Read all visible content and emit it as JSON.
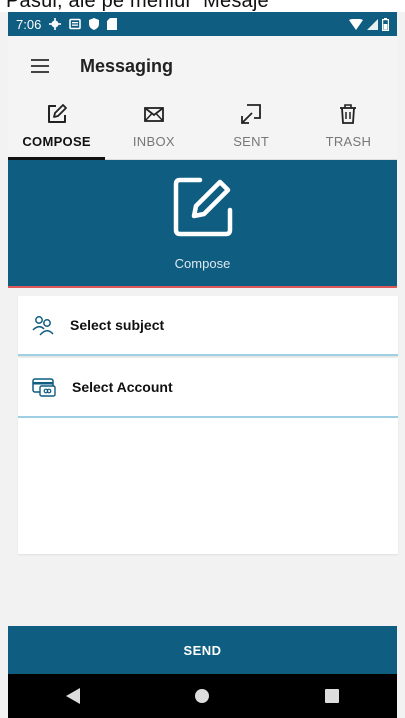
{
  "caption": "Pasul, ale pe meniul \"Mesaje\"",
  "status_bar": {
    "time": "7:06"
  },
  "app_bar": {
    "title": "Messaging",
    "menu_icon": "hamburger-icon"
  },
  "tabs": [
    {
      "label": "COMPOSE",
      "icon": "compose-icon",
      "active": true
    },
    {
      "label": "INBOX",
      "icon": "envelope-icon",
      "active": false
    },
    {
      "label": "SENT",
      "icon": "sent-icon",
      "active": false
    },
    {
      "label": "TRASH",
      "icon": "trash-icon",
      "active": false
    }
  ],
  "hero": {
    "label": "Compose",
    "icon": "compose-icon"
  },
  "form": {
    "subject": {
      "label": "Select subject",
      "icon": "people-icon"
    },
    "account": {
      "label": "Select Account",
      "icon": "card-icon"
    }
  },
  "send": {
    "label": "SEND"
  },
  "nav": {
    "back_icon": "back-icon",
    "home_icon": "home-icon",
    "recents_icon": "recents-icon"
  },
  "colors": {
    "primary": "#0f5d80",
    "accent_underline": "#e0575a",
    "row_divider": "#9fcfe3"
  }
}
